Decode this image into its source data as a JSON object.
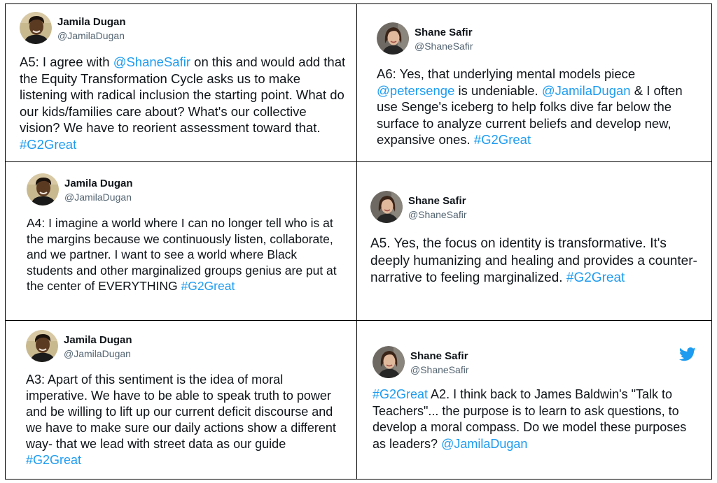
{
  "tweets": [
    {
      "name": "Jamila Dugan",
      "handle": "@JamilaDugan",
      "segments": [
        {
          "text": "A5: I agree with ",
          "link": false
        },
        {
          "text": "@ShaneSafir",
          "link": true
        },
        {
          "text": " on this and would add that the Equity Transformation Cycle asks us to make listening with radical inclusion the starting point. What do our kids/families care about? What's our collective vision? We have to reorient assessment toward that. ",
          "link": false
        },
        {
          "text": "#G2Great",
          "link": true
        }
      ]
    },
    {
      "name": "Shane Safir",
      "handle": "@ShaneSafir",
      "segments": [
        {
          "text": "A6: Yes, that underlying mental models piece ",
          "link": false
        },
        {
          "text": "@petersenge",
          "link": true
        },
        {
          "text": " is undeniable. ",
          "link": false
        },
        {
          "text": "@JamilaDugan",
          "link": true
        },
        {
          "text": " & I often use Senge's iceberg to help folks dive far below the surface to analyze current beliefs and develop new, expansive ones. ",
          "link": false
        },
        {
          "text": "#G2Great",
          "link": true
        }
      ]
    },
    {
      "name": "Jamila Dugan",
      "handle": "@JamilaDugan",
      "segments": [
        {
          "text": "A4: I imagine a world where I can no longer tell who is at the margins because we continuously listen, collaborate, and we partner. I want to see a world where Black students and other marginalized groups genius are put at the center of EVERYTHING ",
          "link": false
        },
        {
          "text": "#G2Great",
          "link": true
        }
      ]
    },
    {
      "name": "Shane Safir",
      "handle": "@ShaneSafir",
      "segments": [
        {
          "text": "A5. Yes, the focus on identity is transformative. It's deeply humanizing and healing and provides a counter-narrative to feeling marginalized. ",
          "link": false
        },
        {
          "text": "#G2Great",
          "link": true
        }
      ]
    },
    {
      "name": "Jamila Dugan",
      "handle": "@JamilaDugan",
      "segments": [
        {
          "text": "A3: Apart of this sentiment is the idea of moral imperative. We have to be able to speak truth to power and be willing to lift up our current deficit discourse and we have to make sure our daily actions show a different way- that we lead with street data as our guide ",
          "link": false
        },
        {
          "text": "#G2Great",
          "link": true
        }
      ]
    },
    {
      "name": "Shane Safir",
      "handle": "@ShaneSafir",
      "segments": [
        {
          "text": "#G2Great",
          "link": true
        },
        {
          "text": " A2. I think back to James Baldwin's \"Talk to Teachers\"... the purpose is to learn to ask questions, to develop a moral compass. Do we model these purposes as leaders? ",
          "link": false
        },
        {
          "text": "@JamilaDugan",
          "link": true
        }
      ]
    }
  ],
  "colors": {
    "link": "#1d9bf0",
    "handle": "#536471",
    "text": "#0f1419",
    "twitter_brand": "#1d9bf0"
  },
  "icons": {
    "tweet6_brand": "twitter-bird-icon"
  }
}
